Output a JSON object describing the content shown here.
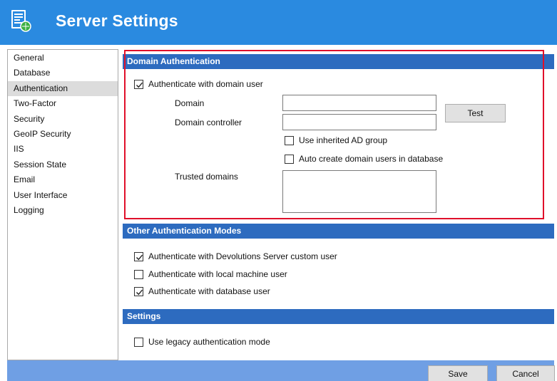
{
  "window": {
    "title": "Server Settings"
  },
  "sidebar": {
    "items": [
      {
        "label": "General"
      },
      {
        "label": "Database"
      },
      {
        "label": "Authentication",
        "selected": true
      },
      {
        "label": "Two-Factor"
      },
      {
        "label": "Security"
      },
      {
        "label": "GeoIP Security"
      },
      {
        "label": "IIS"
      },
      {
        "label": "Session State"
      },
      {
        "label": "Email"
      },
      {
        "label": "User Interface"
      },
      {
        "label": "Logging"
      }
    ]
  },
  "domain_auth": {
    "header": "Domain Authentication",
    "authenticate_domain_user": {
      "label": "Authenticate with domain user",
      "checked": true
    },
    "domain_label": "Domain",
    "domain_value": "",
    "controller_label": "Domain controller",
    "controller_value": "",
    "test_button": "Test",
    "inherited_ad_group": {
      "label": "Use inherited AD group",
      "checked": false
    },
    "auto_create_users": {
      "label": "Auto create domain users in database",
      "checked": false
    },
    "trusted_domains_label": "Trusted domains",
    "trusted_domains_value": ""
  },
  "other_auth": {
    "header": "Other Authentication Modes",
    "custom_user": {
      "label": "Authenticate with Devolutions Server custom user",
      "checked": true
    },
    "local_machine_user": {
      "label": "Authenticate with local machine user",
      "checked": false
    },
    "database_user": {
      "label": "Authenticate with database user",
      "checked": true
    }
  },
  "settings": {
    "header": "Settings",
    "legacy_mode": {
      "label": "Use legacy authentication mode",
      "checked": false
    }
  },
  "footer": {
    "save_label": "Save",
    "cancel_label": "Cancel"
  },
  "colors": {
    "title_bar": "#2a8ae0",
    "section_header": "#2d6bbf",
    "footer_bar": "#6f9fe4",
    "highlight_border": "#e0102a"
  }
}
